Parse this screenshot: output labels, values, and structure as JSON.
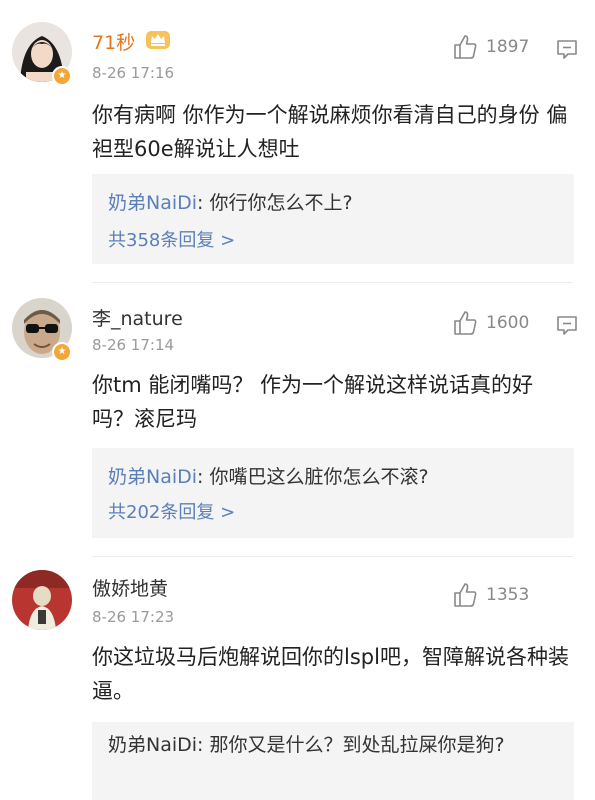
{
  "comments": [
    {
      "username": "71秒",
      "time": "8-26 17:16",
      "likes": "1897",
      "text": "你有病啊 你作为一个解说麻烦你看清自己的身份 偏袒型60e解说让人想吐",
      "reply_author": "奶弟NaiDi",
      "reply_text": ": 你行你怎么不上?",
      "more_replies": "共358条回复 >"
    },
    {
      "username": "李_nature",
      "time": "8-26 17:14",
      "likes": "1600",
      "text": "你tm 能闭嘴吗？ 作为一个解说这样说话真的好吗？滚尼玛",
      "reply_author": "奶弟NaiDi",
      "reply_text": ": 你嘴巴这么脏你怎么不滚?",
      "more_replies": "共202条回复 >"
    },
    {
      "username": "傲娇地黄",
      "time": "8-26 17:23",
      "likes": "1353",
      "text": "你这垃圾马后炮解说回你的lspl吧，智障解说各种装逼。",
      "reply_author": "奶弟NaiDi",
      "reply_text": ": 那你又是什么？到处乱拉屎你是狗?"
    }
  ],
  "icons": {
    "like": "thumbs-up-icon",
    "reply": "comment-bubble-icon",
    "verified": "verified-badge-icon",
    "crown": "crown-icon"
  },
  "colors": {
    "vip_name": "#e8751a",
    "link": "#5b7fb8",
    "reply_bg": "#f4f4f4",
    "meta": "#9a9a9a"
  }
}
